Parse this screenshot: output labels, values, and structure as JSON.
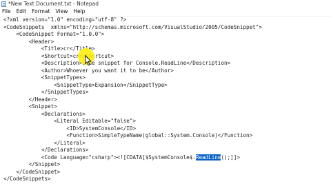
{
  "window": {
    "title": "*New Text Document.txt - Notepad",
    "icon": "notepad-icon"
  },
  "menubar": {
    "items": [
      "File",
      "Edit",
      "Format",
      "View",
      "Help"
    ]
  },
  "editor": {
    "lines": [
      "<?xml version=\"1.0\" encoding=\"utf-8\" ?>",
      "<CodeSnippets  xmlns=\"http://schemas.microsoft.com/VisualStudio/2005/CodeSnippet\">",
      "    <CodeSnippet Format=\"1.0.0\">",
      "        <Header>",
      "            <Title>cr</Title>",
      "            <Shortcut>cr</Shortcut>",
      "            <Description>Code snippet for Console.ReadLine</Description>",
      "            <Author>Whoever you want it to be</Author>",
      "            <SnippetTypes>",
      "                <SnippetType>Expansion</SnippetType>",
      "            </SnippetTypes>",
      "        </Header>",
      "        <Snippet>",
      "            <Declarations>",
      "                <Literal Editable=\"false\">",
      "                    <ID>SystemConsole</ID>",
      "                    <Function>SimpleTypeName(global::System.Console)</Function>",
      "                </Literal>",
      "            </Declarations>",
      "            <Code Language=\"csharp\"><![CDATA[$SystemConsole$.",
      "        </Snippet>",
      "    </CodeSnippet>",
      "</CodeSnippets>"
    ],
    "code_line_selected": "ReadLine",
    "code_line_after": "();]]>",
    "selection_color": "#0a64c8"
  },
  "cursor": {
    "highlight_color": "#ffee00"
  }
}
